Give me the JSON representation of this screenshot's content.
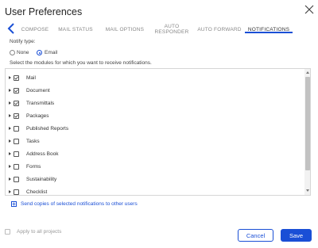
{
  "dialog": {
    "title": "User Preferences"
  },
  "icons": {
    "close": "close-icon",
    "back": "chevron-left-icon",
    "add": "plus-box-icon"
  },
  "colors": {
    "accent": "#1a4fd6"
  },
  "tabs": [
    {
      "label": "COMPOSE",
      "visible_label": "COMPOSE",
      "active": false
    },
    {
      "label": "MAIL STATUS",
      "active": false
    },
    {
      "label": "MAIL OPTIONS",
      "active": false
    },
    {
      "label": "AUTO\nRESPONDER",
      "active": false
    },
    {
      "label": "AUTO FORWARD",
      "active": false
    },
    {
      "label": "NOTIFICATIONS",
      "active": true
    }
  ],
  "notify": {
    "label": "Notify type:",
    "options": [
      {
        "label": "None",
        "selected": false
      },
      {
        "label": "Email",
        "selected": true
      }
    ]
  },
  "modules": {
    "instructions": "Select the modules for which you want to receive notifications.",
    "items": [
      {
        "label": "Mail",
        "checked": true
      },
      {
        "label": "Document",
        "checked": true
      },
      {
        "label": "Transmittals",
        "checked": true
      },
      {
        "label": "Packages",
        "checked": true
      },
      {
        "label": "Published Reports",
        "checked": false
      },
      {
        "label": "Tasks",
        "checked": false
      },
      {
        "label": "Address Book",
        "checked": false
      },
      {
        "label": "Forms",
        "checked": false
      },
      {
        "label": "Sustainability",
        "checked": false
      },
      {
        "label": "Checklist",
        "checked": false
      }
    ]
  },
  "send_copies": {
    "label": "Send copies of selected notifications to other users"
  },
  "footer": {
    "apply_all": {
      "label": "Apply to all projects",
      "checked": false
    },
    "cancel_label": "Cancel",
    "save_label": "Save"
  }
}
